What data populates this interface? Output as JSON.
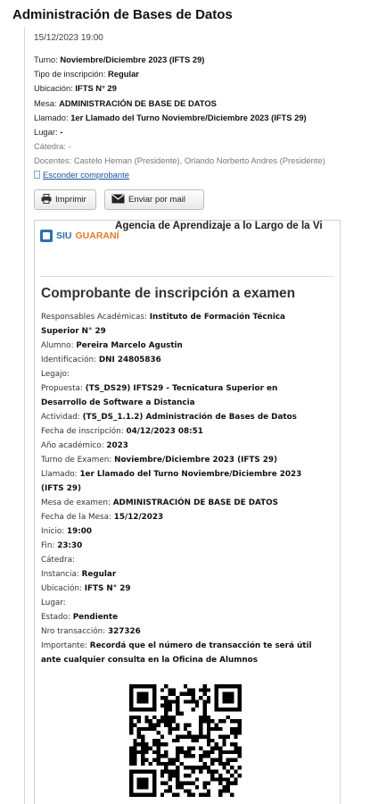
{
  "page": {
    "title": "Administración de Bases de Datos",
    "datetime": "15/12/2023 19:00"
  },
  "info": [
    {
      "label": "Turno:",
      "value": "Noviembre/Diciembre 2023 (IFTS 29)"
    },
    {
      "label": "Tipo de inscripción:",
      "value": "Regular"
    },
    {
      "label": "Ubicación:",
      "value": "IFTS N° 29"
    },
    {
      "label": "Mesa:",
      "value": "ADMINISTRACIÓN DE BASE DE DATOS"
    },
    {
      "label": "Llamado:",
      "value": "1er Llamado del Turno Noviembre/Diciembre 2023 (IFTS 29)"
    },
    {
      "label": "Lugar:",
      "value": "-"
    },
    {
      "label": "Cátedra:",
      "value": "-"
    },
    {
      "label": "Docentes:",
      "value": "Castelo Hernan (Presidente), Orlando Norberto Andres (Presidente)"
    }
  ],
  "toggle_label": "Esconder comprobante",
  "buttons": {
    "print": "Imprimir",
    "mail": "Enviar por mail"
  },
  "receipt": {
    "logo_a": "SIU",
    "logo_b": "GUARANÍ",
    "agency": "Agencia de Aprendizaje a lo Largo de la Vi",
    "title": "Comprobante de inscripción a examen",
    "lines": [
      {
        "label": "Responsables Académicas:",
        "value": "Instituto de Formación Técnica Superior N° 29"
      },
      {
        "label": "Alumno:",
        "value": "Pereira Marcelo Agustin"
      },
      {
        "label": "Identificación:",
        "value": "DNI 24805836"
      },
      {
        "label": "Legajo:",
        "value": ""
      },
      {
        "label": "Propuesta:",
        "value": "(TS_DS29) IFTS29 - Tecnicatura Superior en Desarrollo de Software a Distancia"
      },
      {
        "label": "Actividad:",
        "value": "(TS_DS_1.1.2) Administración de Bases de Datos"
      },
      {
        "label": "Fecha de inscripción:",
        "value": "04/12/2023 08:51"
      },
      {
        "label": "Año académico:",
        "value": "2023"
      },
      {
        "label": "Turno de Examen:",
        "value": "Noviembre/Diciembre 2023 (IFTS 29)"
      },
      {
        "label": "Llamado:",
        "value": "1er Llamado del Turno Noviembre/Diciembre 2023 (IFTS 29)"
      },
      {
        "label": "Mesa de examen:",
        "value": "ADMINISTRACIÓN DE BASE DE DATOS"
      },
      {
        "label": "Fecha de la Mesa:",
        "value": "15/12/2023"
      },
      {
        "label": "Inicio:",
        "value": "19:00"
      },
      {
        "label": "Fin:",
        "value": "23:30"
      },
      {
        "label": "Cátedra:",
        "value": ""
      },
      {
        "label": "Instancia:",
        "value": "Regular"
      },
      {
        "label": "Ubicación:",
        "value": "IFTS N° 29"
      },
      {
        "label": "Lugar:",
        "value": ""
      },
      {
        "label": "Estado:",
        "value": "Pendiente"
      },
      {
        "label": "Nro transacción:",
        "value": "327326"
      },
      {
        "label": "Importante:",
        "value": "Recordá que el número de transacción te será útil ante cualquier consulta en la Oficina de Alumnos"
      }
    ]
  }
}
